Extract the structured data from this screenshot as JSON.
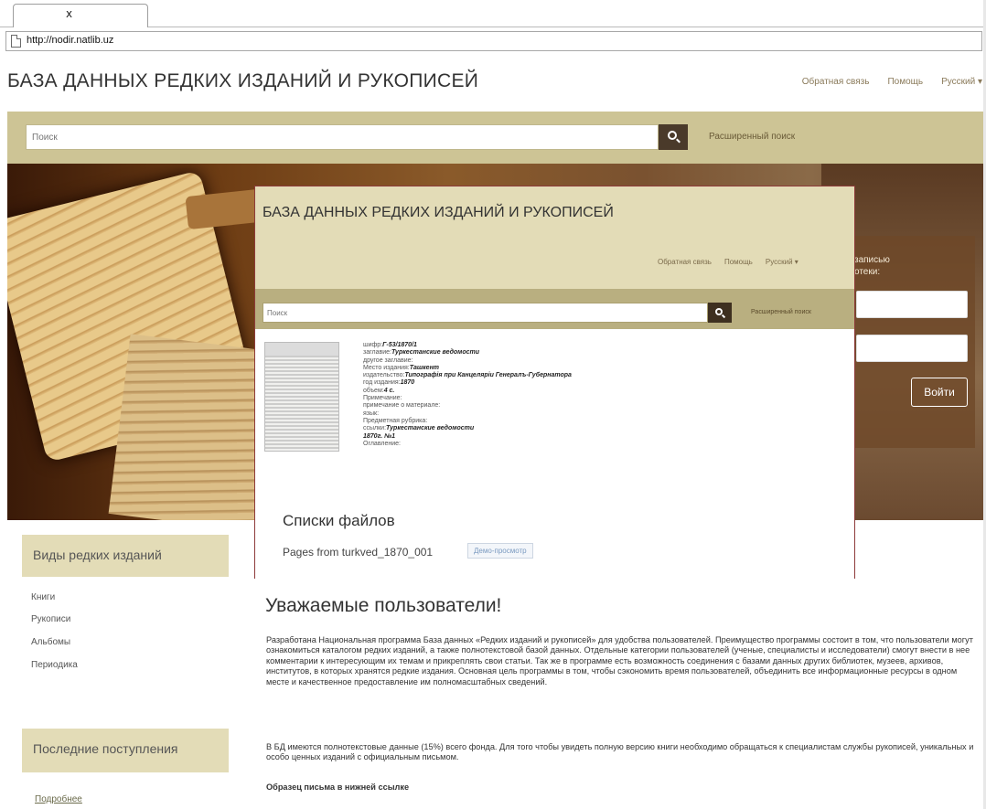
{
  "browser": {
    "tab_close": "x",
    "url": "http://nodir.natlib.uz"
  },
  "header": {
    "title": "БАЗА ДАННЫХ РЕДКИХ ИЗДАНИЙ И РУКОПИСЕЙ",
    "nav": [
      "Обратная связь",
      "Помощь",
      "Русский ▾"
    ]
  },
  "search": {
    "placeholder": "Поиск",
    "advanced_label": "Расширенный поиск"
  },
  "login": {
    "text": "записью\nотеки:",
    "button_label": "Войти"
  },
  "inset": {
    "title": "БАЗА ДАННЫХ РЕДКИХ ИЗДАНИЙ И РУКОПИСЕЙ",
    "nav": [
      "Обратная связь",
      "Помощь",
      "Русский ▾"
    ],
    "search_placeholder": "Поиск",
    "advanced_label": "Расширенный поиск",
    "meta": [
      {
        "label": "шифр:",
        "value": "Г-53/1870/1"
      },
      {
        "label": "заглавие:",
        "value": "Туркестанские ведомости"
      },
      {
        "label": "другое заглавие:",
        "value": ""
      },
      {
        "label": "Место издания:",
        "value": "Ташкент"
      },
      {
        "label": "издательство:",
        "value": "Типографія при Канцеляріи Генералъ-Губернатора"
      },
      {
        "label": "год издания:",
        "value": "1870"
      },
      {
        "label": "объем:",
        "value": "4 с."
      },
      {
        "label": "Примечание:",
        "value": ""
      },
      {
        "label": "примечание о материале:",
        "value": ""
      },
      {
        "label": "язык:",
        "value": ""
      },
      {
        "label": "Предметная рубрика:",
        "value": ""
      },
      {
        "label": "ссылки:",
        "value": "Туркестанские ведомости"
      },
      {
        "label": "",
        "value": "1870г. №1"
      },
      {
        "label": "Оглавление:",
        "value": ""
      }
    ],
    "files_title": "Списки файлов",
    "file_name": "Pages from turkved_1870_001",
    "demo_label": "Демо-просмотр"
  },
  "sidebar": {
    "types_heading": "Виды редких изданий",
    "items": [
      "Книги",
      "Рукописи",
      "Альбомы",
      "Периодика"
    ],
    "recent_heading": "Последние поступления",
    "more_label": "Подробнее"
  },
  "main": {
    "greeting": "Уважаемые пользователи!",
    "paragraph1": "Разработана Национальная программа База данных «Редких изданий и рукописей» для удобства пользователей. Преимущество программы состоит в том, что пользователи могут ознакомиться каталогом редких изданий, а также полнотекстовой базой данных. Отдельные категории пользователей (ученые, специалисты и исследователи) смогут внести в нее комментарии к интересующим их темам и прикреплять свои статьи. Так же в программе есть возможность соединения с базами данных других библиотек, музеев, архивов, институтов, в которых хранятся редкие издания. Основная цель программы в том, чтобы сэкономить время пользователей, объединить все информационные ресурсы в одном месте и качественное предоставление им полномасштабных сведений.",
    "paragraph2": "В БД имеются полнотекстовые данные (15%) всего фонда. Для того чтобы увидеть полную версию книги необходимо обращаться к специалистам службы рукописей, уникальных и особо ценных изданий с официальным письмом.",
    "paragraph3": "Образец письма в нижней ссылке"
  }
}
